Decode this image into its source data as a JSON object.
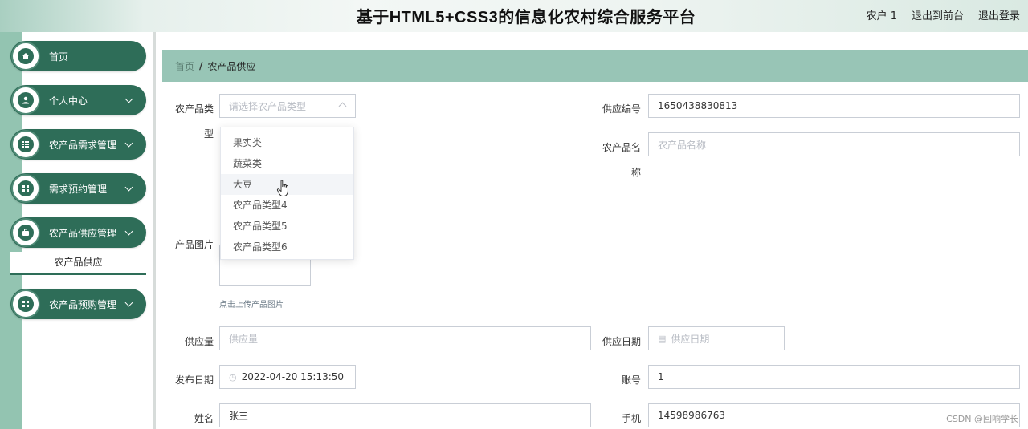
{
  "header": {
    "title": "基于HTML5+CSS3的信息化农村综合服务平台",
    "user": "农户 1",
    "back_to_front": "退出到前台",
    "logout": "退出登录"
  },
  "sidebar": {
    "items": [
      {
        "label": "首页",
        "icon": "home-icon"
      },
      {
        "label": "个人中心",
        "icon": "user-icon"
      },
      {
        "label": "农产品需求管理",
        "icon": "grid-icon"
      },
      {
        "label": "需求预约管理",
        "icon": "apps-icon"
      },
      {
        "label": "农产品供应管理",
        "icon": "briefcase-icon"
      },
      {
        "label": "农产品预购管理",
        "icon": "apps-icon"
      }
    ],
    "active_sub": "农产品供应"
  },
  "breadcrumb": {
    "home": "首页",
    "sep": "/",
    "current": "农产品供应"
  },
  "form": {
    "type_label_1": "农产品类",
    "type_label_2": "型",
    "type_placeholder": "请选择农产品类型",
    "supply_no_label": "供应编号",
    "supply_no_value": "1650438830813",
    "product_name_label_1": "农产品名",
    "product_name_label_2": "称",
    "product_name_placeholder": "农产品名称",
    "image_label": "产品图片",
    "upload_tip": "点击上传产品图片",
    "qty_label": "供应量",
    "qty_placeholder": "供应量",
    "supply_date_label": "供应日期",
    "supply_date_placeholder": "供应日期",
    "publish_date_label": "发布日期",
    "publish_date_value": "2022-04-20 15:13:50",
    "account_label": "账号",
    "account_value": "1",
    "name_label": "姓名",
    "name_value": "张三",
    "phone_label": "手机",
    "phone_value": "14598986763"
  },
  "dropdown": {
    "options": [
      "果实类",
      "蔬菜类",
      "大豆",
      "农产品类型4",
      "农产品类型5",
      "农产品类型6"
    ],
    "hovered": "大豆"
  },
  "watermark": "CSDN @回响学长",
  "colors": {
    "sidebar_item": "#2e6d58",
    "breadcrumb_bg": "#98c5b6",
    "rail": "#93c4b1"
  }
}
